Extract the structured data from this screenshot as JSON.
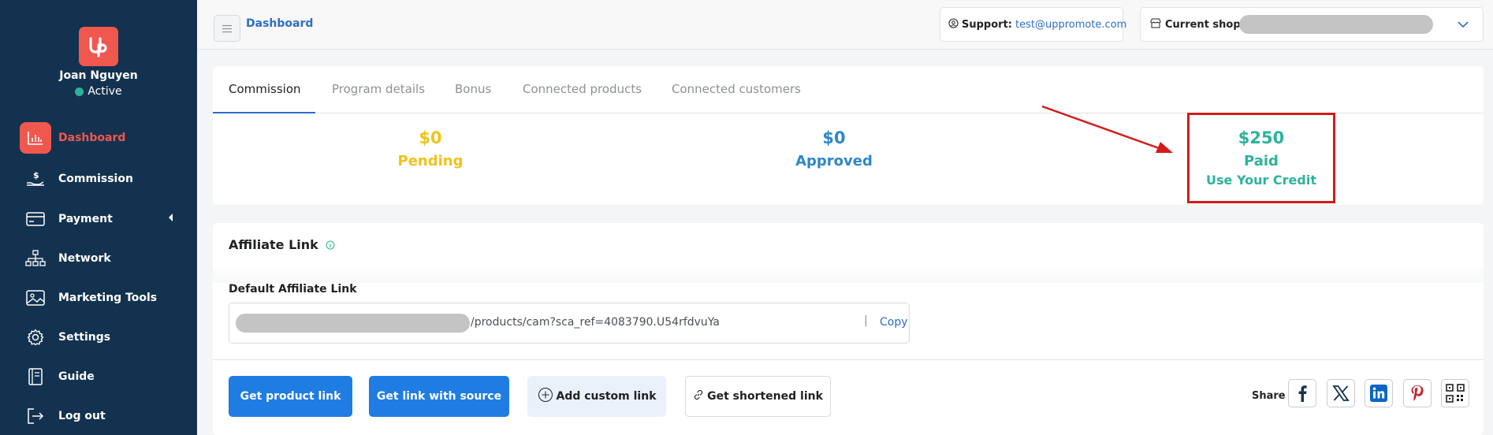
{
  "sidebar": {
    "user_name": "Joan Nguyen",
    "status": "Active",
    "items": [
      {
        "label": "Dashboard",
        "icon": "chart-icon"
      },
      {
        "label": "Commission",
        "icon": "hand-coin-icon"
      },
      {
        "label": "Payment",
        "icon": "card-icon"
      },
      {
        "label": "Network",
        "icon": "network-icon"
      },
      {
        "label": "Marketing Tools",
        "icon": "image-icon"
      },
      {
        "label": "Settings",
        "icon": "gear-icon"
      },
      {
        "label": "Guide",
        "icon": "book-icon"
      },
      {
        "label": "Log out",
        "icon": "logout-icon"
      }
    ]
  },
  "topbar": {
    "breadcrumb": "Dashboard",
    "support_label": "Support:",
    "support_email": "test@uppromote.com",
    "shop_label": "Current shop:"
  },
  "commission": {
    "tabs": [
      "Commission",
      "Program details",
      "Bonus",
      "Connected products",
      "Connected customers"
    ],
    "pending": {
      "value": "$0",
      "label": "Pending"
    },
    "approved": {
      "value": "$0",
      "label": "Approved"
    },
    "paid": {
      "value": "$250",
      "label": "Paid",
      "action": "Use Your Credit"
    }
  },
  "affiliate": {
    "title": "Affiliate Link",
    "default_label": "Default Affiliate Link",
    "link_suffix": "/products/cam?sca_ref=4083790.U54rfdvuYa",
    "separator": "|",
    "copy_label": "Copy",
    "buttons": {
      "product_link": "Get product link",
      "link_with_source": "Get link with source",
      "custom_link": "Add custom link",
      "shortened_link": "Get shortened link"
    },
    "share_label": "Share"
  },
  "colors": {
    "sidebar_bg": "#13324f",
    "brand_red": "#f0574f",
    "pending": "#f1c21b",
    "approved": "#2d87c7",
    "paid": "#2bb39a",
    "primary_button": "#1f7ce3",
    "annotation": "#d31b1b"
  }
}
